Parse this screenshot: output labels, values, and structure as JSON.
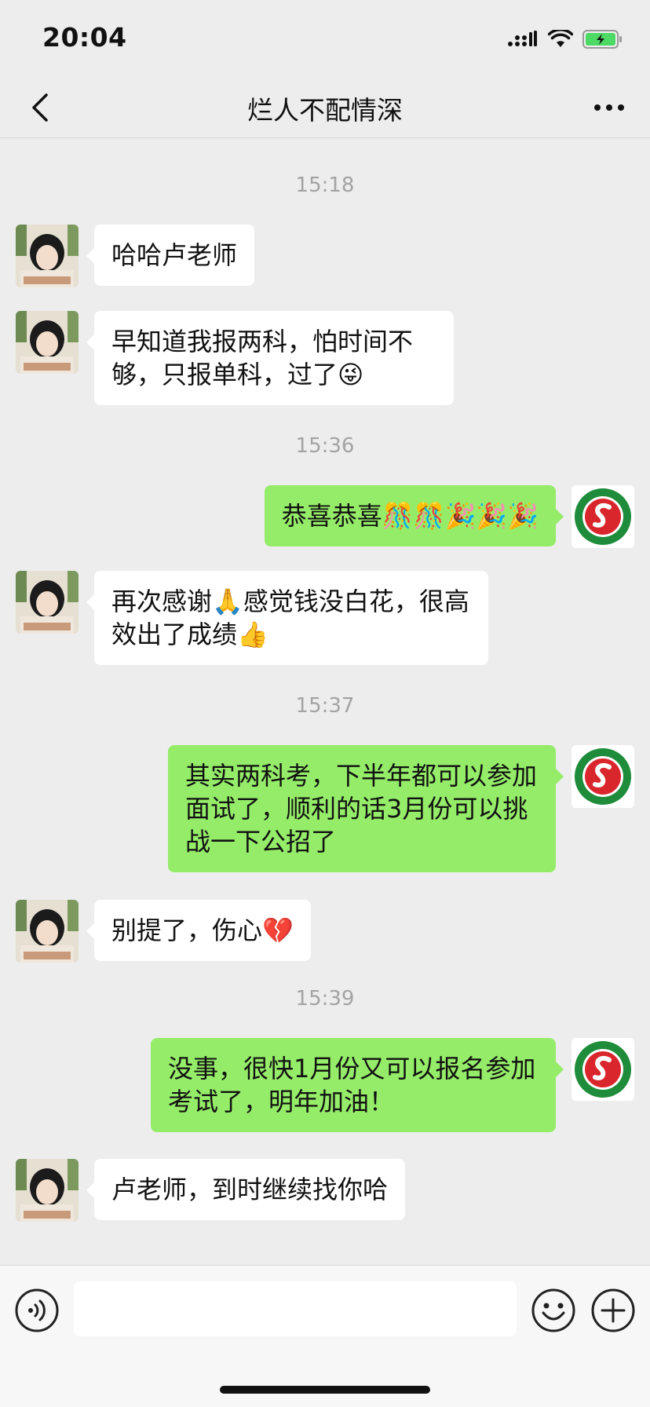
{
  "status_bar": {
    "time": "20:04",
    "icons": [
      "cellular-signal-icon",
      "wifi-icon",
      "battery-charging-icon"
    ],
    "battery_color": "#4cd964"
  },
  "nav": {
    "title": "烂人不配情深",
    "back_icon": "chevron-left-icon",
    "more_icon": "more-dots-icon"
  },
  "messages": [
    {
      "type": "time",
      "text": "15:18"
    },
    {
      "type": "message",
      "side": "left",
      "text": "哈哈卢老师"
    },
    {
      "type": "message",
      "side": "left",
      "text": "早知道我报两科，怕时间不够，只报单科，过了😜"
    },
    {
      "type": "time",
      "text": "15:36"
    },
    {
      "type": "message",
      "side": "right",
      "text": "恭喜恭喜🎊🎊🎉🎉🎉"
    },
    {
      "type": "message",
      "side": "left",
      "text": "再次感谢🙏感觉钱没白花，很高效出了成绩👍"
    },
    {
      "type": "time",
      "text": "15:37"
    },
    {
      "type": "message",
      "side": "right",
      "text": "其实两科考，下半年都可以参加面试了，顺利的话3月份可以挑战一下公招了"
    },
    {
      "type": "message",
      "side": "left",
      "text": "别提了，伤心💔"
    },
    {
      "type": "time",
      "text": "15:39"
    },
    {
      "type": "message",
      "side": "right",
      "text": "没事，很快1月份又可以报名参加考试了，明年加油！"
    },
    {
      "type": "message",
      "side": "left",
      "text": "卢老师，到时继续找你哈"
    }
  ],
  "input_bar": {
    "voice_icon": "voice-input-icon",
    "input_value": "",
    "emoji_icon": "emoji-smile-icon",
    "plus_icon": "plus-circle-icon"
  },
  "colors": {
    "background": "#ededed",
    "bubble_self": "#95ec69",
    "bubble_other": "#ffffff",
    "time_text": "#a3a3a3",
    "logo_red": "#d9262c",
    "logo_green": "#1e8c3a"
  }
}
